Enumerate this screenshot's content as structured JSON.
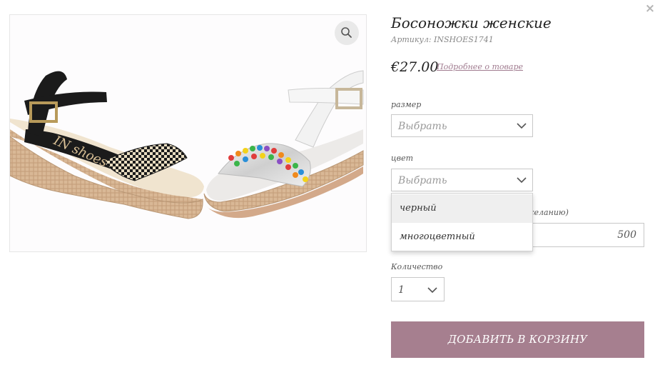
{
  "close_label": "×",
  "product": {
    "title": "Босоножки женские",
    "sku": "Артикул: INSHOES1741",
    "price": "€27.00",
    "more_link": "Подробнее о товаре",
    "image_alt": "Two espadrille wedge sandals: black and multicolor",
    "image_brand_text": "IN shoes"
  },
  "size": {
    "label": "размер",
    "value": "Выбрать"
  },
  "color": {
    "label": "цвет",
    "value": "Выбрать",
    "options": [
      "черный",
      "многоцветный"
    ],
    "highlighted_option": "черный"
  },
  "engraving": {
    "label_fragment": "желанию)",
    "value": "500"
  },
  "quantity": {
    "label": "Количество",
    "value": "1"
  },
  "add_to_cart": "ДОБАВИТЬ В КОРЗИНУ",
  "colors": {
    "accent": "#a67f8f",
    "link": "#a07b8f"
  }
}
